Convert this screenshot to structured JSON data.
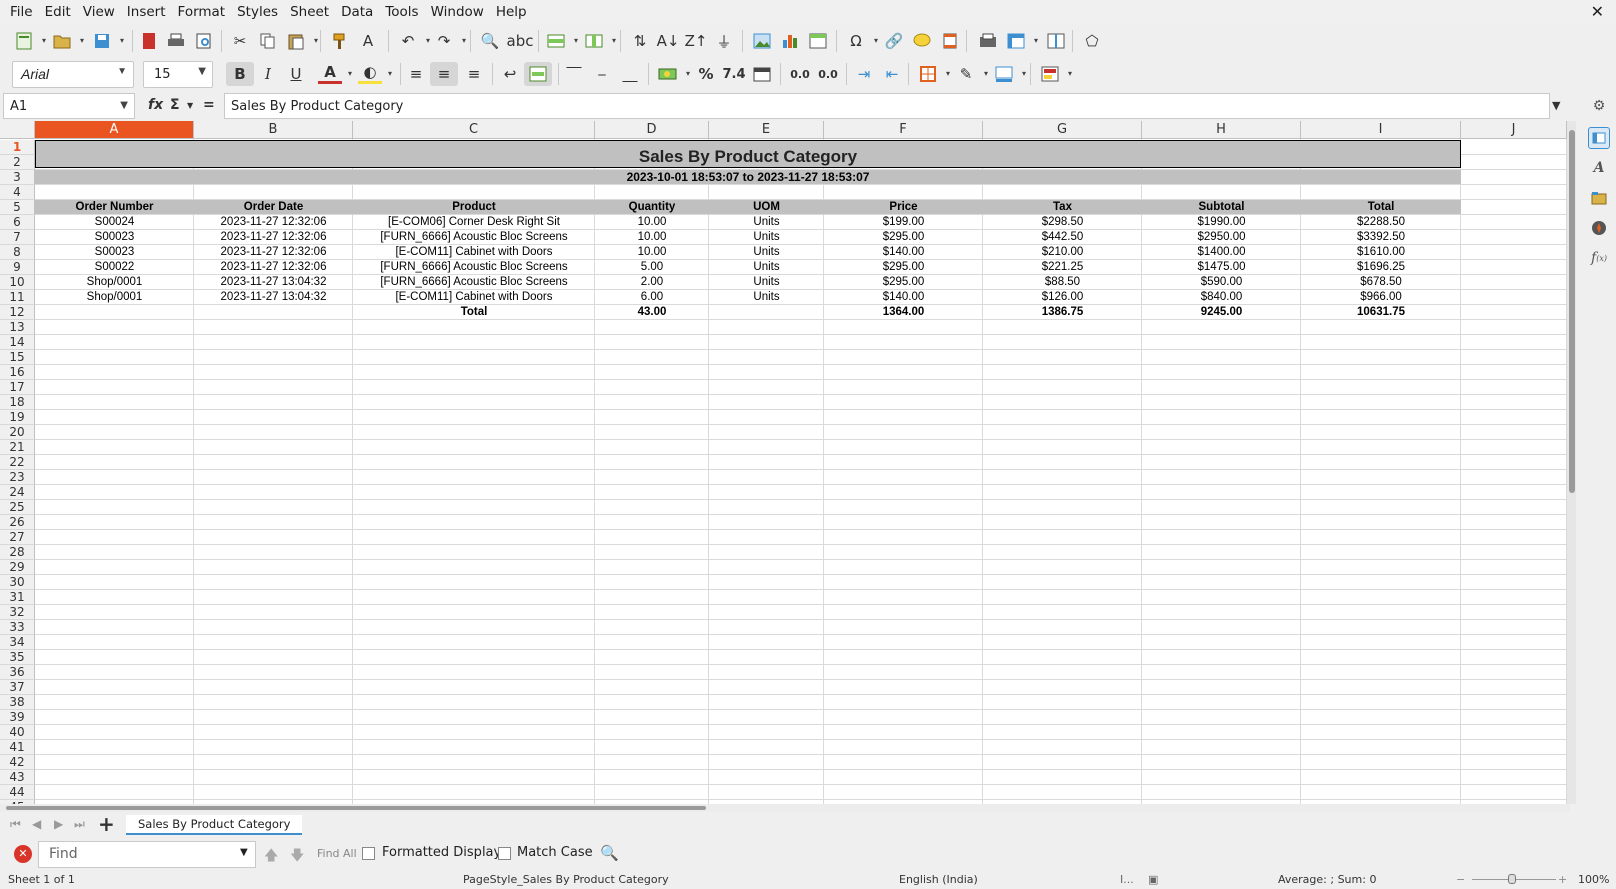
{
  "menu": [
    "File",
    "Edit",
    "View",
    "Insert",
    "Format",
    "Styles",
    "Sheet",
    "Data",
    "Tools",
    "Window",
    "Help"
  ],
  "toolbar": {
    "font_name": "Arial",
    "font_size": "15",
    "bold_label": "B",
    "italic_label": "I",
    "underline_label": "U",
    "percent_label": "%",
    "number_label": "7.4",
    "add_decimal_label": "0.0",
    "del_decimal_label": "0.0"
  },
  "formula_bar": {
    "cell_ref": "A1",
    "fx_label": "fx",
    "sum_label": "Σ",
    "eq_label": "=",
    "content": "Sales By Product Category"
  },
  "columns": [
    "A",
    "B",
    "C",
    "D",
    "E",
    "F",
    "G",
    "H",
    "I",
    "J"
  ],
  "rows": [
    "1",
    "2",
    "3",
    "4",
    "5",
    "6",
    "7",
    "8",
    "9",
    "10",
    "11",
    "12",
    "13",
    "14",
    "15",
    "16",
    "17",
    "18",
    "19",
    "20",
    "21",
    "22",
    "23",
    "24",
    "25",
    "26",
    "27",
    "28",
    "29",
    "30",
    "31",
    "32",
    "33",
    "34",
    "35",
    "36",
    "37",
    "38",
    "39",
    "40",
    "41",
    "42",
    "43",
    "44",
    "45"
  ],
  "sheet": {
    "title": "Sales By Product Category",
    "date_range": "2023-10-01 18:53:07 to 2023-11-27 18:53:07",
    "headers": [
      "Order Number",
      "Order Date",
      "Product",
      "Quantity",
      "UOM",
      "Price",
      "Tax",
      "Subtotal",
      "Total"
    ],
    "data_rows": [
      [
        "S00024",
        "2023-11-27 12:32:06",
        "[E-COM06] Corner Desk Right Sit",
        "10.00",
        "Units",
        "$199.00",
        "$298.50",
        "$1990.00",
        "$2288.50"
      ],
      [
        "S00023",
        "2023-11-27 12:32:06",
        "[FURN_6666] Acoustic Bloc Screens",
        "10.00",
        "Units",
        "$295.00",
        "$442.50",
        "$2950.00",
        "$3392.50"
      ],
      [
        "S00023",
        "2023-11-27 12:32:06",
        "[E-COM11] Cabinet with Doors",
        "10.00",
        "Units",
        "$140.00",
        "$210.00",
        "$1400.00",
        "$1610.00"
      ],
      [
        "S00022",
        "2023-11-27 12:32:06",
        "[FURN_6666] Acoustic Bloc Screens",
        "5.00",
        "Units",
        "$295.00",
        "$221.25",
        "$1475.00",
        "$1696.25"
      ],
      [
        "Shop/0001",
        "2023-11-27 13:04:32",
        "[FURN_6666] Acoustic Bloc Screens",
        "2.00",
        "Units",
        "$295.00",
        "$88.50",
        "$590.00",
        "$678.50"
      ],
      [
        "Shop/0001",
        "2023-11-27 13:04:32",
        "[E-COM11] Cabinet with Doors",
        "6.00",
        "Units",
        "$140.00",
        "$126.00",
        "$840.00",
        "$966.00"
      ]
    ],
    "total_row": [
      "",
      "",
      "Total",
      "43.00",
      "",
      "1364.00",
      "1386.75",
      "9245.00",
      "10631.75"
    ]
  },
  "tabs": {
    "sheet_tab": "Sales By Product Category"
  },
  "find": {
    "placeholder": "Find",
    "find_all": "Find All",
    "formatted_display": "Formatted Display",
    "match_case": "Match Case"
  },
  "status": {
    "sheet": "Sheet 1 of 1",
    "page_style": "PageStyle_Sales By Product Category",
    "language": "English (India)",
    "selection": "Average: ; Sum: 0",
    "zoom": "100%"
  }
}
